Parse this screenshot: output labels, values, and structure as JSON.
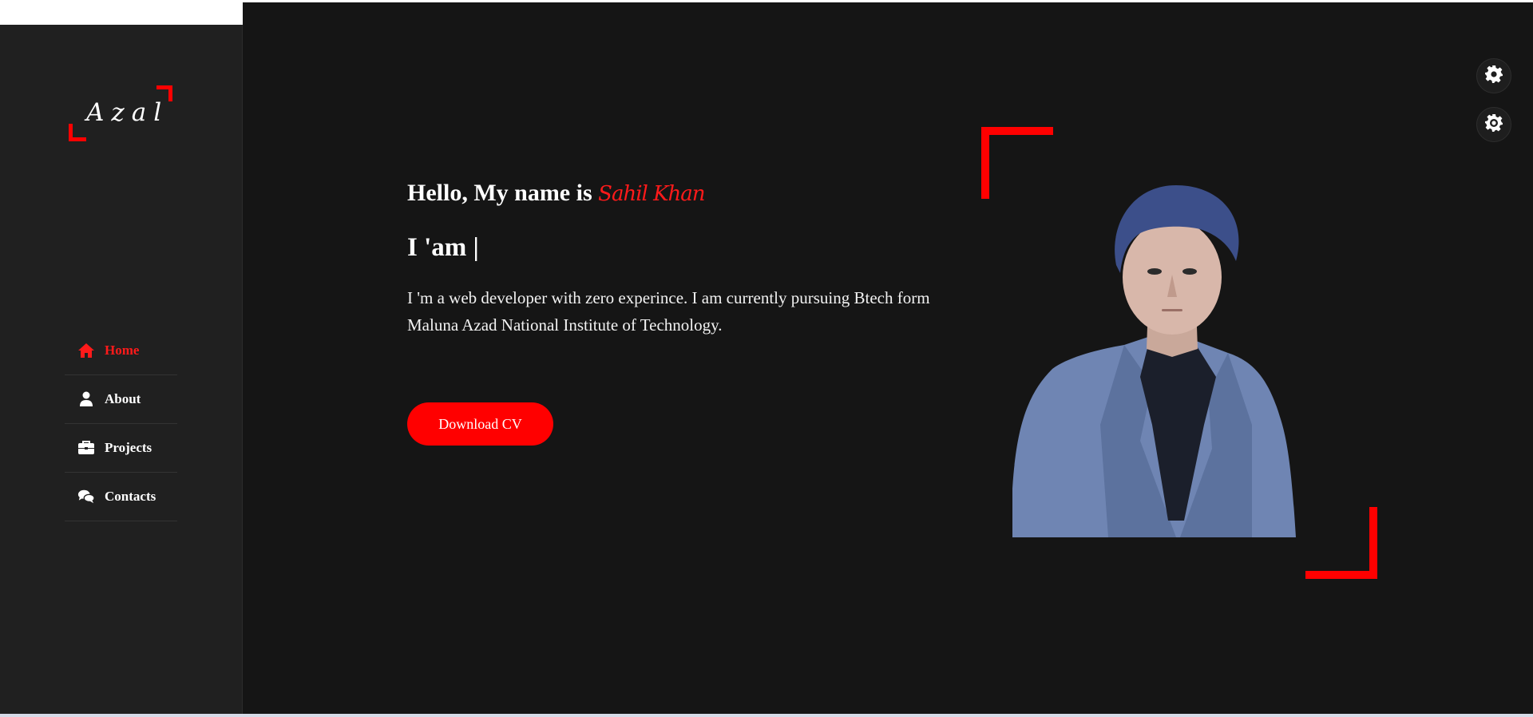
{
  "logo": {
    "text": "Azal"
  },
  "nav": {
    "items": [
      {
        "label": "Home",
        "icon": "home-icon",
        "active": true
      },
      {
        "label": "About",
        "icon": "user-icon",
        "active": false
      },
      {
        "label": "Projects",
        "icon": "briefcase-icon",
        "active": false
      },
      {
        "label": "Contacts",
        "icon": "comments-icon",
        "active": false
      }
    ]
  },
  "hero": {
    "greeting_prefix": "Hello, My name is ",
    "name": "Sahil Khan",
    "role": "I 'am |",
    "bio": "I 'm a web developer with zero experince. I am currently pursuing Btech form Maluna Azad National Institute of Technology.",
    "cv_button": "Download CV"
  },
  "settings": {
    "buttons": [
      "gear-icon",
      "sun-gear-icon"
    ]
  },
  "colors": {
    "accent": "#ff0000",
    "sidebar_bg": "#202020",
    "main_bg": "#151515",
    "text": "#ffffff"
  }
}
